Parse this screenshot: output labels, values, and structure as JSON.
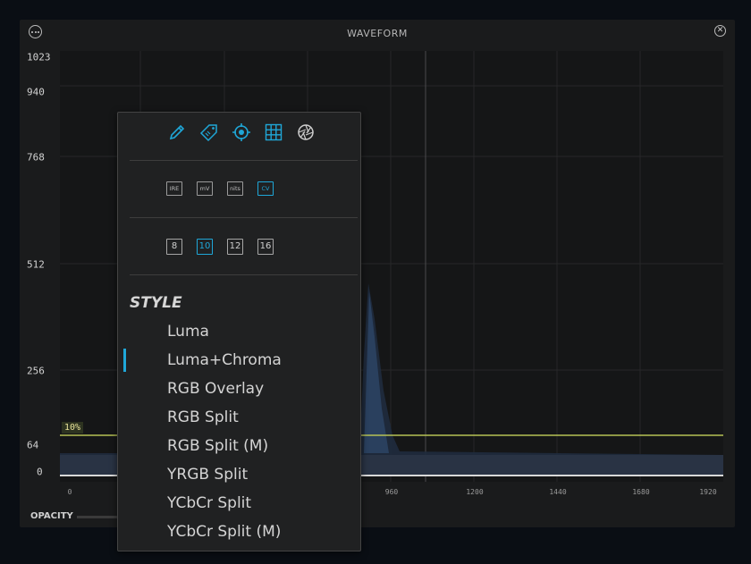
{
  "panel": {
    "title": "WAVEFORM",
    "menu_icon": "ellipsis-circle-icon",
    "close_icon": "close-circle-icon"
  },
  "scope": {
    "y_ticks": [
      "1023",
      "940",
      "768",
      "512",
      "256",
      "64",
      "0"
    ],
    "x_ticks": [
      "0",
      "960",
      "1200",
      "1440",
      "1680",
      "1920"
    ],
    "target_label": "10%",
    "target_line_color": "#b7c255",
    "opacity_label": "OPACITY"
  },
  "popup": {
    "tools": [
      {
        "name": "eyedropper-icon",
        "active": true
      },
      {
        "name": "tag-icon",
        "active": true
      },
      {
        "name": "crosshair-target-icon",
        "active": true
      },
      {
        "name": "grid-icon",
        "active": true
      },
      {
        "name": "aperture-icon",
        "active": false
      }
    ],
    "units": [
      {
        "label": "IRE",
        "active": false
      },
      {
        "label": "mV",
        "active": false
      },
      {
        "label": "nits",
        "active": false
      },
      {
        "label": "CV",
        "active": true
      }
    ],
    "bit_depths": [
      {
        "label": "8",
        "active": false
      },
      {
        "label": "10",
        "active": true
      },
      {
        "label": "12",
        "active": false
      },
      {
        "label": "16",
        "active": false
      }
    ],
    "style_heading": "STYLE",
    "styles": [
      "Luma",
      "Luma+Chroma",
      "RGB Overlay",
      "RGB Split",
      "RGB Split (M)",
      "YRGB Split",
      "YCbCr Split",
      "YCbCr Split (M)"
    ],
    "selected_style": "Luma+Chroma",
    "accent_color": "#1fa7d8"
  }
}
